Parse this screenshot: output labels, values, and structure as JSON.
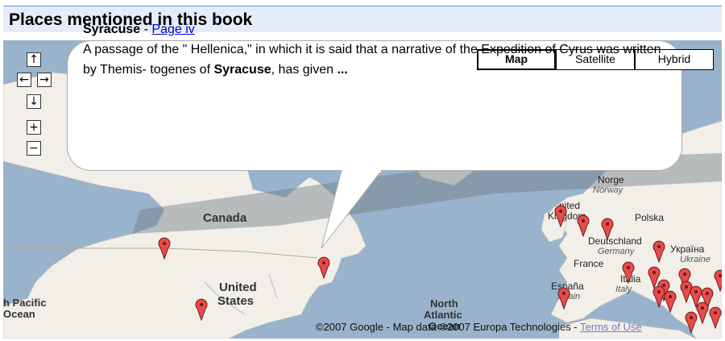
{
  "header": {
    "title": "Places mentioned in this book"
  },
  "map": {
    "labels": {
      "canada": "Canada",
      "united_states_1": "United",
      "united_states_2": "States",
      "north_pacific_1": "h Pacific",
      "north_pacific_2": "Ocean",
      "north_atlantic_1": "North",
      "north_atlantic_2": "Atlantic",
      "north_atlantic_3": "Ocean",
      "norge": "Norge",
      "norway": "Norway",
      "united_kingdom_1": "nited",
      "united_kingdom_2": "Kingdom",
      "polska": "Polska",
      "deutschland": "Deutschland",
      "germany": "Germany",
      "ukraina": "Україна",
      "ukraine": "Ukraine",
      "france": "France",
      "italia": "Italia",
      "italy": "Italy",
      "espana": "España",
      "spain": "Spain"
    },
    "copyright": {
      "text": "©2007 Google - Map data ©2007 Europa Technologies - ",
      "terms_link": "Terms of Use"
    },
    "map_types": [
      {
        "label": "Map",
        "selected": true
      },
      {
        "label": "Satellite",
        "selected": false
      },
      {
        "label": "Hybrid",
        "selected": false
      }
    ],
    "nav": {
      "pan_up": "↑",
      "pan_left": "←",
      "pan_right": "→",
      "pan_down": "↓",
      "zoom_in": "+",
      "zoom_out": "−"
    }
  },
  "info_window": {
    "place": "Syracuse",
    "separator": " - ",
    "page_link": "Page iv",
    "snippet_before": "A passage of the \" Hellenica,\" in which it is said that a narrative of the Expedition of Cyrus was written by Themis- togenes of ",
    "snippet_bold": "Syracuse",
    "snippet_after": ", has given ",
    "ellipsis": "..."
  },
  "colors": {
    "header_bg": "#e5ecf9",
    "header_border": "#6b90da",
    "water": "#99b3cc",
    "land": "#f2efe9",
    "pin": "#e84b4b",
    "link": "#0000cc"
  }
}
